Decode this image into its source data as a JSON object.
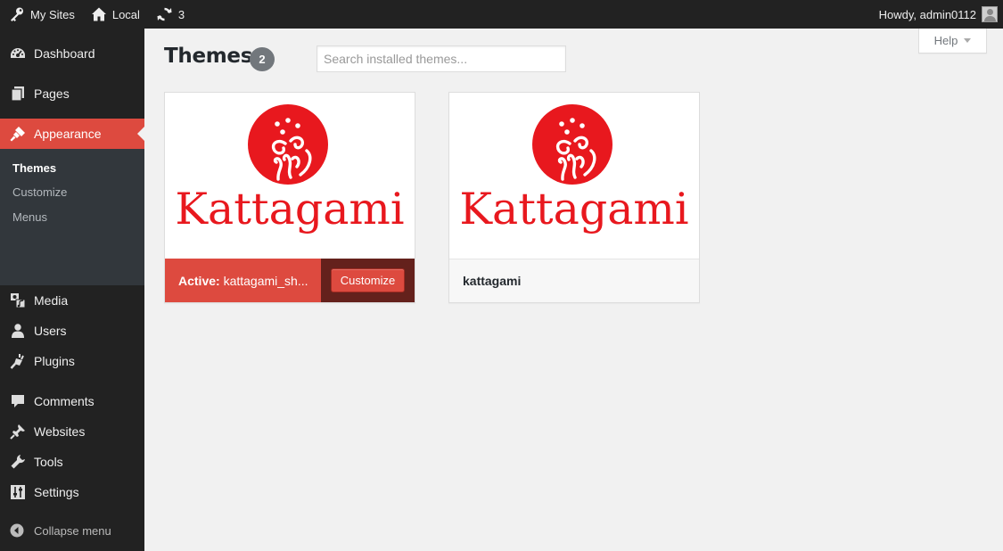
{
  "adminbar": {
    "my_sites": "My Sites",
    "site": "Local",
    "updates_count": "3",
    "greeting": "Howdy, admin0112"
  },
  "sidebar": {
    "items": [
      {
        "label": "Dashboard",
        "icon": "dashboard-icon"
      },
      {
        "label": "Pages",
        "icon": "pages-icon"
      },
      {
        "label": "Appearance",
        "icon": "appearance-icon"
      },
      {
        "label": "Media",
        "icon": "media-icon"
      },
      {
        "label": "Users",
        "icon": "users-icon"
      },
      {
        "label": "Plugins",
        "icon": "plugins-icon"
      },
      {
        "label": "Comments",
        "icon": "comments-icon"
      },
      {
        "label": "Websites",
        "icon": "pin-icon"
      },
      {
        "label": "Tools",
        "icon": "wrench-icon"
      },
      {
        "label": "Settings",
        "icon": "settings-icon"
      }
    ],
    "submenu": [
      "Themes",
      "Customize",
      "Menus"
    ],
    "collapse_label": "Collapse menu"
  },
  "main": {
    "title": "Themes",
    "count": "2",
    "search_placeholder": "Search installed themes...",
    "help_label": "Help"
  },
  "themes": [
    {
      "logo_text": "Kattagami",
      "active_prefix": "Active:",
      "name": "kattagami_sh...",
      "customize_label": "Customize"
    },
    {
      "logo_text": "Kattagami",
      "name": "kattagami"
    }
  ],
  "colors": {
    "accent": "#dd4a3f",
    "brand_red": "#e8181e",
    "sidebar_bg": "#222222"
  }
}
